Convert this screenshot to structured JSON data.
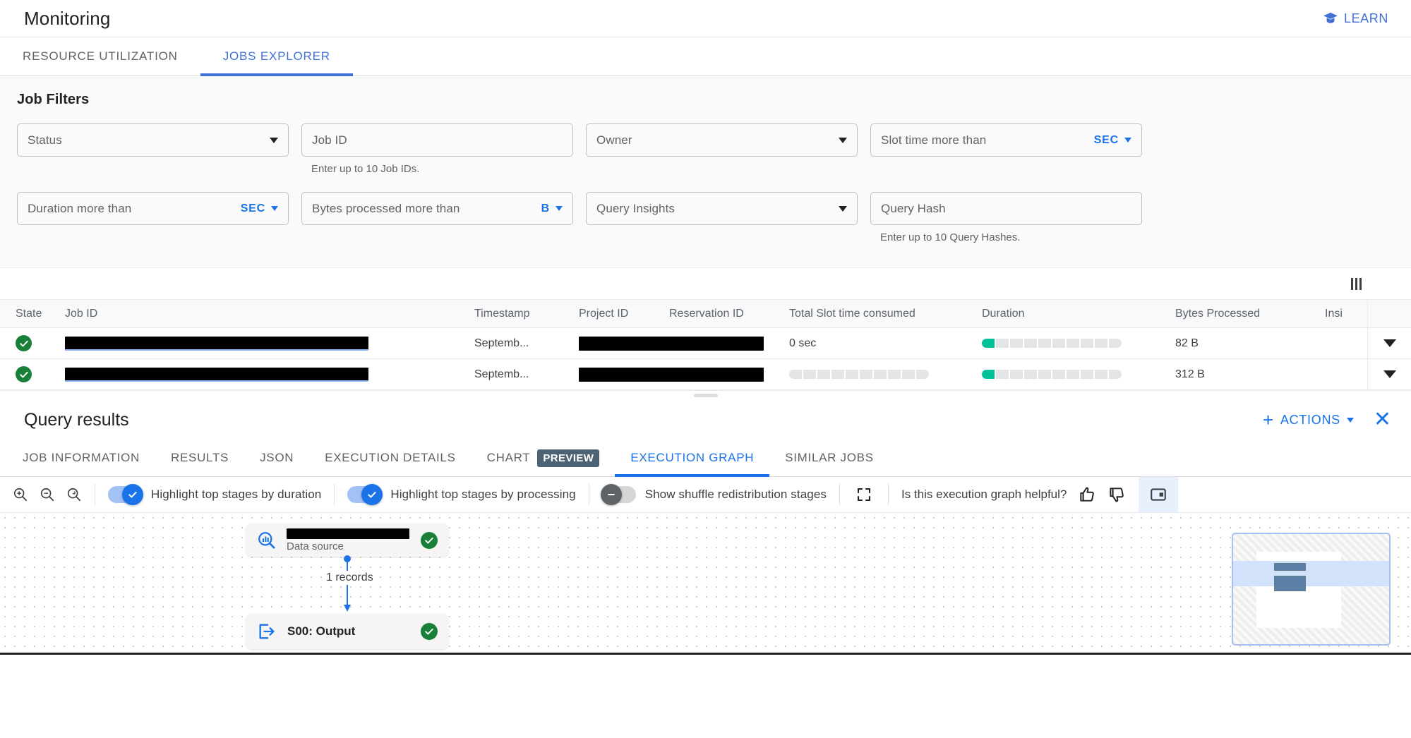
{
  "header": {
    "title": "Monitoring",
    "learn_label": "LEARN",
    "learn_icon": "graduation-cap-icon"
  },
  "tabs": [
    {
      "label": "RESOURCE UTILIZATION",
      "active": false
    },
    {
      "label": "JOBS EXPLORER",
      "active": true
    }
  ],
  "filters": {
    "title": "Job Filters",
    "fields": [
      {
        "label": "Status",
        "type": "select",
        "value": "",
        "unit": null,
        "helper": null
      },
      {
        "label": "Job ID",
        "type": "text",
        "value": "",
        "unit": null,
        "helper": "Enter up to 10 Job IDs."
      },
      {
        "label": "Owner",
        "type": "select",
        "value": "",
        "unit": null,
        "helper": null
      },
      {
        "label": "Slot time more than",
        "type": "unit",
        "value": "",
        "unit": "SEC",
        "helper": null
      },
      {
        "label": "Duration more than",
        "type": "unit",
        "value": "",
        "unit": "SEC",
        "helper": null
      },
      {
        "label": "Bytes processed more than",
        "type": "unit",
        "value": "",
        "unit": "B",
        "helper": null
      },
      {
        "label": "Query Insights",
        "type": "select",
        "value": "",
        "unit": null,
        "helper": null
      },
      {
        "label": "Query Hash",
        "type": "text",
        "value": "",
        "unit": null,
        "helper": "Enter up to 10 Query Hashes."
      }
    ]
  },
  "jobs_table": {
    "column_settings_icon": "columns-icon",
    "columns": [
      "State",
      "Job ID",
      "Timestamp",
      "Project ID",
      "Reservation ID",
      "Total Slot time consumed",
      "Duration",
      "Bytes Processed",
      "Insi"
    ],
    "rows": [
      {
        "state": "success",
        "job_id": "",
        "timestamp": "Septemb...",
        "project_id": "",
        "reservation_id": "",
        "slot_time": "0 sec",
        "slot_bar_filled": 0,
        "duration": "",
        "duration_bar_filled": 1,
        "bytes": "82 B",
        "expand_icon": "chevron-down-icon"
      },
      {
        "state": "success",
        "job_id": "",
        "timestamp": "Septemb...",
        "project_id": "",
        "reservation_id": "",
        "slot_time": "",
        "slot_bar_filled": 0,
        "duration": "",
        "duration_bar_filled": 1,
        "bytes": "312 B",
        "expand_icon": "chevron-down-icon"
      }
    ]
  },
  "query_results": {
    "title": "Query results",
    "actions_label": "ACTIONS",
    "close_icon": "close-icon",
    "tabs": [
      {
        "label": "JOB INFORMATION",
        "badge": null,
        "active": false
      },
      {
        "label": "RESULTS",
        "badge": null,
        "active": false
      },
      {
        "label": "JSON",
        "badge": null,
        "active": false
      },
      {
        "label": "EXECUTION DETAILS",
        "badge": null,
        "active": false
      },
      {
        "label": "CHART",
        "badge": "PREVIEW",
        "active": false
      },
      {
        "label": "EXECUTION GRAPH",
        "badge": null,
        "active": true
      },
      {
        "label": "SIMILAR JOBS",
        "badge": null,
        "active": false
      }
    ]
  },
  "graph_toolbar": {
    "zoom_in_icon": "zoom-in-icon",
    "zoom_out_icon": "zoom-out-icon",
    "zoom_reset_icon": "zoom-reset-icon",
    "toggles": [
      {
        "label": "Highlight top stages by duration",
        "on": true
      },
      {
        "label": "Highlight top stages by processing",
        "on": true
      },
      {
        "label": "Show shuffle redistribution stages",
        "on": false
      }
    ],
    "fullscreen_icon": "fullscreen-icon",
    "feedback_question": "Is this execution graph helpful?",
    "thumb_up_icon": "thumb-up-icon",
    "thumb_down_icon": "thumb-down-icon",
    "side_panel_icon": "side-panel-icon"
  },
  "graph": {
    "nodes": [
      {
        "id": "n0",
        "label": "",
        "sublabel": "Data source",
        "icon": "data-source-search-icon",
        "status": "success",
        "redacted": true
      },
      {
        "id": "n1",
        "label": "S00: Output",
        "sublabel": "",
        "icon": "output-arrow-icon",
        "status": "success",
        "redacted": false
      }
    ],
    "edges": [
      {
        "from": "n0",
        "to": "n1",
        "label": "1 records"
      }
    ],
    "minimap": {
      "name": "graph-minimap"
    }
  }
}
